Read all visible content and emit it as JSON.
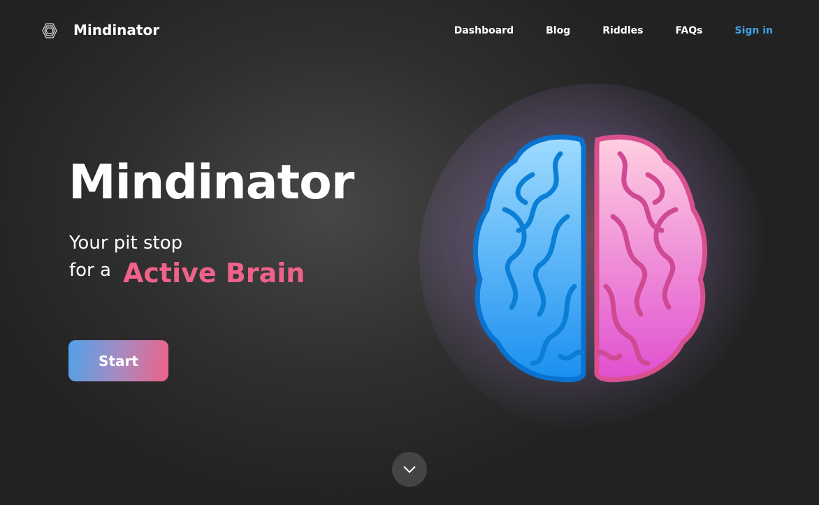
{
  "nav": {
    "brand": "Mindinator",
    "logo_icon": "hexagon-layers-icon",
    "links": [
      "Dashboard",
      "Blog",
      "Riddles",
      "FAQs"
    ],
    "sign_in": "Sign in"
  },
  "hero": {
    "title": "Mindinator",
    "subtitle_line1": "Your pit stop",
    "subtitle_line2": "for a",
    "accent_text": "Active Brain",
    "start_label": "Start",
    "illustration": "brain-icon",
    "scroll_icon": "chevron-down-icon"
  },
  "colors": {
    "accent": "#f0628a",
    "link": "#3fa3e6",
    "brain_left": "#1e9cf0",
    "brain_right": "#e35ccd"
  }
}
